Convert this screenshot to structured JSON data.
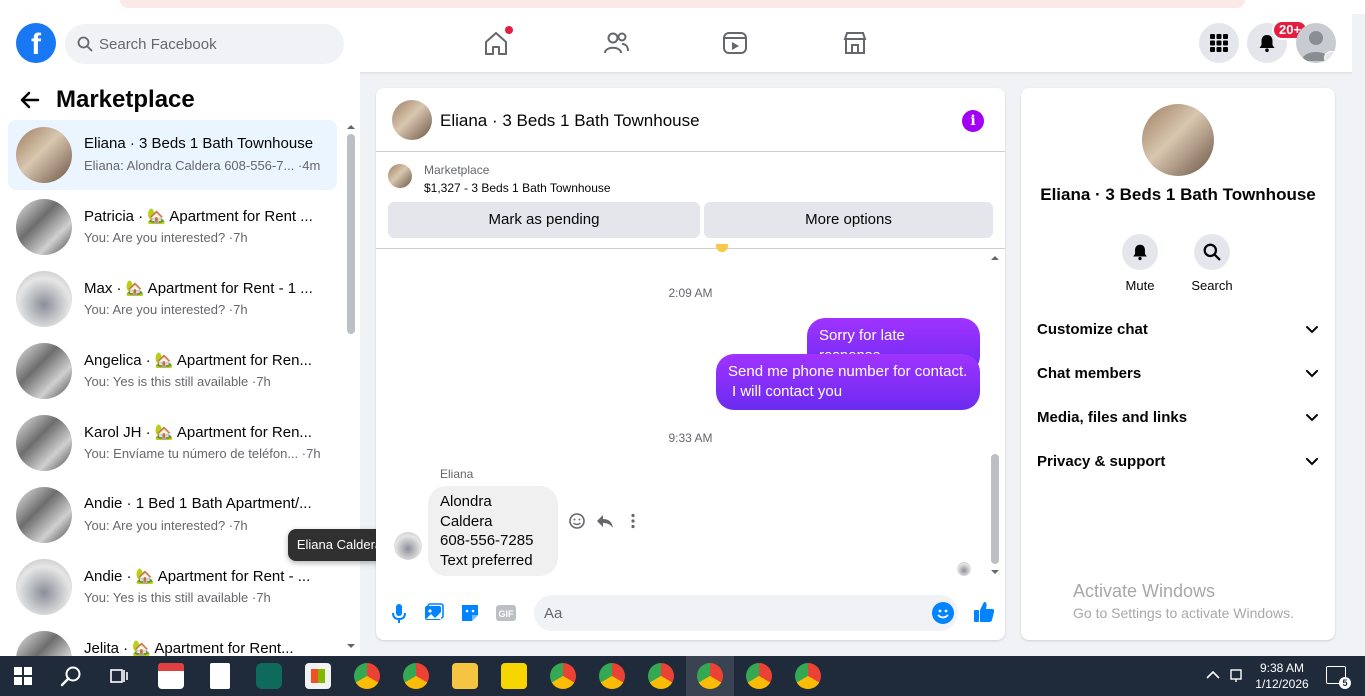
{
  "header": {
    "search_placeholder": "Search Facebook",
    "notification_badge": "20+"
  },
  "sidebar": {
    "title": "Marketplace",
    "conversations": [
      {
        "name": "Eliana · 3 Beds 1 Bath Townhouse",
        "preview": "Eliana: Alondra Caldera 608-556-7... ·4m",
        "active": true
      },
      {
        "name": "Patricia · 🏡 Apartment for Rent ...",
        "preview": "You: Are you interested? ·7h"
      },
      {
        "name": "Max · 🏡 Apartment for Rent - 1 ...",
        "preview": "You: Are you interested? ·7h"
      },
      {
        "name": "Angelica · 🏡 Apartment for Ren...",
        "preview": "You: Yes is this still available ·7h"
      },
      {
        "name": "Karol JH · 🏡 Apartment for Ren...",
        "preview": "You: Envíame tu número de teléfon... ·7h"
      },
      {
        "name": "Andie · 1 Bed 1 Bath Apartment/...",
        "preview": "You: Are you interested? ·7h"
      },
      {
        "name": "Andie · 🏡 Apartment for Rent - ...",
        "preview": "You: Yes is this still available ·7h"
      },
      {
        "name": "Jelita · 🏡 Apartment for Rent...",
        "preview": ""
      }
    ],
    "tooltip": "Eliana Caldera"
  },
  "chat": {
    "title": "Eliana · 3 Beds 1 Bath Townhouse",
    "listing_source": "Marketplace",
    "listing_title": "$1,327 - 3 Beds 1 Bath Townhouse",
    "mark_pending_label": "Mark as pending",
    "more_options_label": "More options",
    "time1": "2:09 AM",
    "out_msg1": "Sorry for late response",
    "out_msg2_line1": "Send me phone number for contact.",
    "out_msg2_line2": "I will contact you",
    "time2": "9:33 AM",
    "sender": "Eliana",
    "in_msg_line1": "Alondra Caldera",
    "in_msg_line2": "608-556-7285",
    "in_msg_line3": "Text preferred",
    "input_placeholder": "Aa"
  },
  "details": {
    "title": "Eliana · 3 Beds 1 Bath Townhouse",
    "mute_label": "Mute",
    "search_label": "Search",
    "sections": [
      "Customize chat",
      "Chat members",
      "Media, files and links",
      "Privacy & support"
    ]
  },
  "watermark": {
    "line1": "Activate Windows",
    "line2": "Go to Settings to activate Windows."
  },
  "taskbar": {
    "time": "9:38 AM",
    "date": "1/12/2026",
    "notif_count": "5"
  },
  "colors": {
    "brand": "#1877f2",
    "messenger_purple": "#a033ff",
    "badge_red": "#e41e3f"
  }
}
